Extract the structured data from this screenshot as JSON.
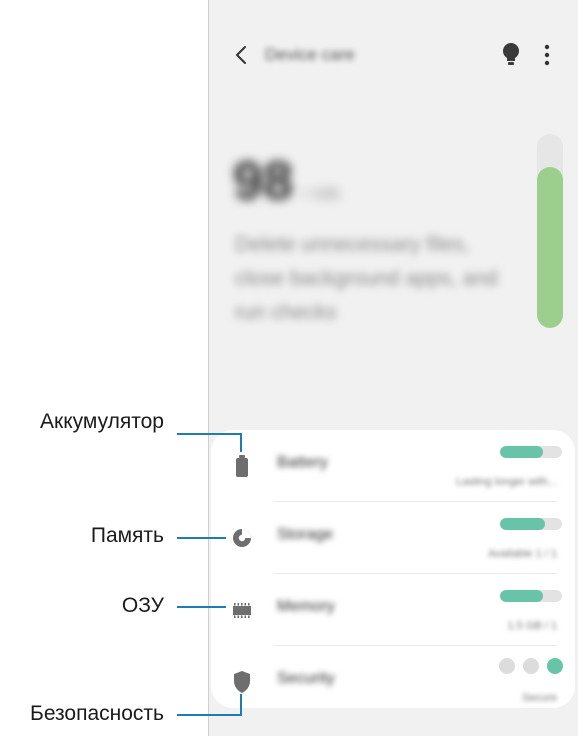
{
  "header": {
    "title": "Device care"
  },
  "optimization": {
    "score": "98",
    "score_suffix": "/ 100",
    "description": "Delete unnecessary files, close background apps, and run checks",
    "score_level": 0.83
  },
  "items": [
    {
      "key": "battery",
      "label": "Battery",
      "value": "Lasting longer with...",
      "level": 0.7
    },
    {
      "key": "storage",
      "label": "Storage",
      "value": "Available 1 / 1",
      "level": 0.72
    },
    {
      "key": "memory",
      "label": "Memory",
      "value": "1.5 GB / 1",
      "level": 0.7
    },
    {
      "key": "security",
      "label": "Security",
      "value": "Secure"
    }
  ],
  "callouts": {
    "battery": "Аккумулятор",
    "storage": "Память",
    "memory": "ОЗУ",
    "security": "Безопасность"
  },
  "colors": {
    "accent_green": "#9ccf8e",
    "bar_teal": "#68c4a8",
    "callout_line": "#1f7bb6",
    "icon_gray": "#6e6e6e"
  },
  "icons": {
    "back": "chevron-left-icon",
    "tip": "lightbulb-icon",
    "more": "more-vertical-icon",
    "battery": "battery-icon",
    "storage": "pie-chart-icon",
    "memory": "memory-chip-icon",
    "security": "shield-icon"
  }
}
